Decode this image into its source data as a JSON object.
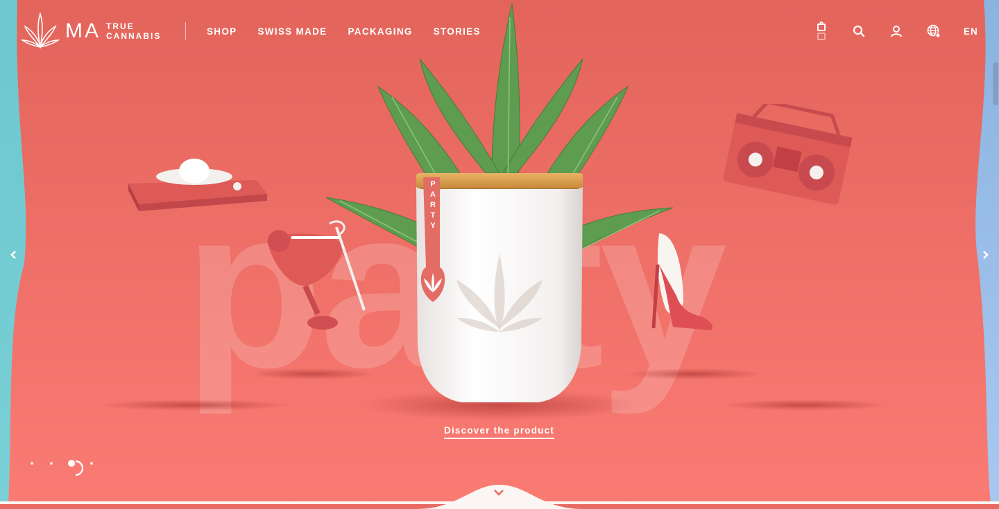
{
  "brand": {
    "monogram": "MA",
    "line1": "TRUE",
    "line2": "CANNABIS"
  },
  "nav": {
    "items": [
      "SHOP",
      "SWISS MADE",
      "PACKAGING",
      "STORIES"
    ]
  },
  "header": {
    "language": "EN",
    "icons": [
      "bag-icon",
      "search-icon",
      "user-icon",
      "globe-icon"
    ]
  },
  "hero": {
    "big_word": "party",
    "jar_label": "PARTY",
    "cta": "Discover the product",
    "slides_total": 4,
    "slide_active": 3
  },
  "colors": {
    "hero_bg": "#e86a62",
    "left_edge": "#6dc7cf",
    "right_edge": "#a9c8f0",
    "jar": "#ffffff",
    "lid": "#e0a455",
    "leaf": "#5b9a4e"
  }
}
